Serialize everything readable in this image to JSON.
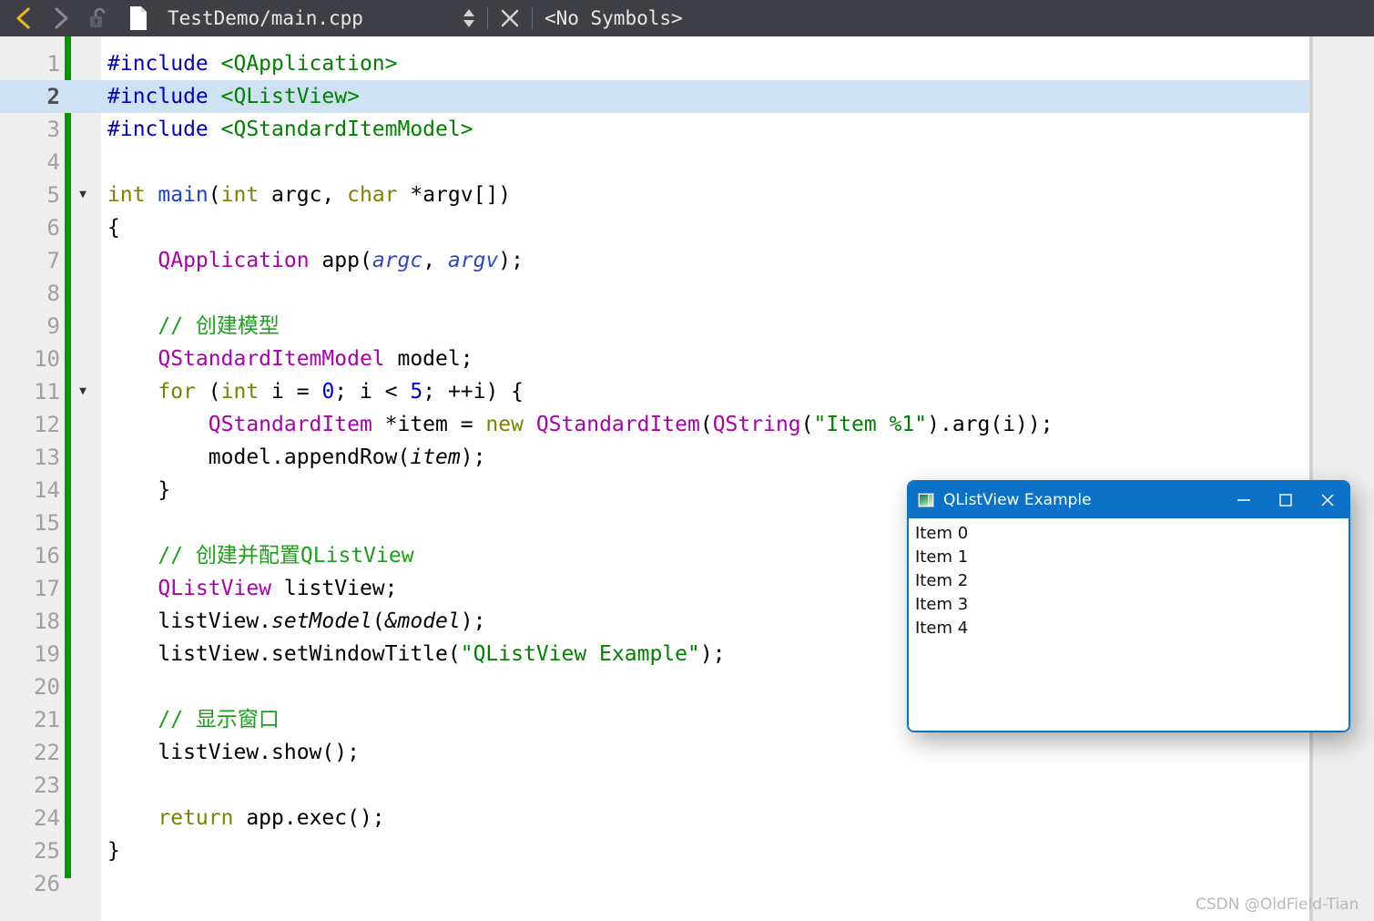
{
  "toolbar": {
    "back_icon": "chevron-left-icon",
    "forward_icon": "chevron-right-icon",
    "lock_icon": "unlocked-padlock-icon",
    "file_icon": "document-icon",
    "file_path": "TestDemo/main.cpp",
    "updown_icon": "up-down-arrows-icon",
    "close_icon": "close-x-icon",
    "symbols_label": "<No Symbols>",
    "bg_color": "#3f3f46",
    "back_icon_color": "#e8b424",
    "forward_icon_color": "#8a8a90"
  },
  "editor": {
    "gutter_bg": "#eeeeee",
    "change_bar_color": "#009900",
    "highlight_color": "#cfe2f3",
    "highlighted_line": 2,
    "fold_lines": [
      5,
      11
    ],
    "total_lines": 26,
    "lines": [
      {
        "n": "1",
        "tokens": [
          {
            "t": "#include ",
            "c": "s-pre"
          },
          {
            "t": "<QApplication>",
            "c": "s-str"
          }
        ]
      },
      {
        "n": "2",
        "tokens": [
          {
            "t": "#include ",
            "c": "s-pre"
          },
          {
            "t": "<QListView>",
            "c": "s-str"
          }
        ]
      },
      {
        "n": "3",
        "tokens": [
          {
            "t": "#include ",
            "c": "s-pre"
          },
          {
            "t": "<QStandardItemModel>",
            "c": "s-str"
          }
        ]
      },
      {
        "n": "4",
        "tokens": []
      },
      {
        "n": "5",
        "tokens": [
          {
            "t": "int ",
            "c": "s-kw"
          },
          {
            "t": "main",
            "c": "s-fn"
          },
          {
            "t": "(",
            "c": "s-plain"
          },
          {
            "t": "int",
            "c": "s-kw"
          },
          {
            "t": " argc, ",
            "c": "s-plain"
          },
          {
            "t": "char",
            "c": "s-kw"
          },
          {
            "t": " *argv[])",
            "c": "s-plain"
          }
        ]
      },
      {
        "n": "6",
        "tokens": [
          {
            "t": "{",
            "c": "s-plain"
          }
        ]
      },
      {
        "n": "7",
        "tokens": [
          {
            "t": "    ",
            "c": "s-plain"
          },
          {
            "t": "QApplication",
            "c": "s-type"
          },
          {
            "t": " app(",
            "c": "s-plain"
          },
          {
            "t": "argc",
            "c": "s-param"
          },
          {
            "t": ", ",
            "c": "s-plain"
          },
          {
            "t": "argv",
            "c": "s-param"
          },
          {
            "t": ");",
            "c": "s-plain"
          }
        ]
      },
      {
        "n": "8",
        "tokens": []
      },
      {
        "n": "9",
        "tokens": [
          {
            "t": "    // 创建模型",
            "c": "s-cmt"
          }
        ]
      },
      {
        "n": "10",
        "tokens": [
          {
            "t": "    ",
            "c": "s-plain"
          },
          {
            "t": "QStandardItemModel",
            "c": "s-type"
          },
          {
            "t": " model;",
            "c": "s-plain"
          }
        ]
      },
      {
        "n": "11",
        "tokens": [
          {
            "t": "    ",
            "c": "s-plain"
          },
          {
            "t": "for",
            "c": "s-kw"
          },
          {
            "t": " (",
            "c": "s-plain"
          },
          {
            "t": "int",
            "c": "s-kw"
          },
          {
            "t": " i = ",
            "c": "s-plain"
          },
          {
            "t": "0",
            "c": "s-num"
          },
          {
            "t": "; i < ",
            "c": "s-plain"
          },
          {
            "t": "5",
            "c": "s-num"
          },
          {
            "t": "; ++i) {",
            "c": "s-plain"
          }
        ]
      },
      {
        "n": "12",
        "tokens": [
          {
            "t": "        ",
            "c": "s-plain"
          },
          {
            "t": "QStandardItem",
            "c": "s-type"
          },
          {
            "t": " *item = ",
            "c": "s-plain"
          },
          {
            "t": "new",
            "c": "s-kw"
          },
          {
            "t": " ",
            "c": "s-plain"
          },
          {
            "t": "QStandardItem",
            "c": "s-type"
          },
          {
            "t": "(",
            "c": "s-plain"
          },
          {
            "t": "QString",
            "c": "s-type"
          },
          {
            "t": "(",
            "c": "s-plain"
          },
          {
            "t": "\"Item %1\"",
            "c": "s-str"
          },
          {
            "t": ").arg(i));",
            "c": "s-plain"
          }
        ]
      },
      {
        "n": "13",
        "tokens": [
          {
            "t": "        model.appendRow(",
            "c": "s-plain"
          },
          {
            "t": "item",
            "c": "s-meth"
          },
          {
            "t": ");",
            "c": "s-plain"
          }
        ]
      },
      {
        "n": "14",
        "tokens": [
          {
            "t": "    }",
            "c": "s-plain"
          }
        ]
      },
      {
        "n": "15",
        "tokens": []
      },
      {
        "n": "16",
        "tokens": [
          {
            "t": "    // 创建并配置QListView",
            "c": "s-cmt"
          }
        ]
      },
      {
        "n": "17",
        "tokens": [
          {
            "t": "    ",
            "c": "s-plain"
          },
          {
            "t": "QListView",
            "c": "s-type"
          },
          {
            "t": " listView;",
            "c": "s-plain"
          }
        ]
      },
      {
        "n": "18",
        "tokens": [
          {
            "t": "    listView.",
            "c": "s-plain"
          },
          {
            "t": "setModel",
            "c": "s-meth"
          },
          {
            "t": "(",
            "c": "s-plain"
          },
          {
            "t": "&model",
            "c": "s-meth"
          },
          {
            "t": ");",
            "c": "s-plain"
          }
        ]
      },
      {
        "n": "19",
        "tokens": [
          {
            "t": "    listView.setWindowTitle(",
            "c": "s-plain"
          },
          {
            "t": "\"QListView Example\"",
            "c": "s-str"
          },
          {
            "t": ");",
            "c": "s-plain"
          }
        ]
      },
      {
        "n": "20",
        "tokens": []
      },
      {
        "n": "21",
        "tokens": [
          {
            "t": "    // 显示窗口",
            "c": "s-cmt"
          }
        ]
      },
      {
        "n": "22",
        "tokens": [
          {
            "t": "    listView.show();",
            "c": "s-plain"
          }
        ]
      },
      {
        "n": "23",
        "tokens": []
      },
      {
        "n": "24",
        "tokens": [
          {
            "t": "    ",
            "c": "s-plain"
          },
          {
            "t": "return",
            "c": "s-kw"
          },
          {
            "t": " app.exec();",
            "c": "s-plain"
          }
        ]
      },
      {
        "n": "25",
        "tokens": [
          {
            "t": "}",
            "c": "s-plain"
          }
        ]
      },
      {
        "n": "26",
        "tokens": []
      }
    ]
  },
  "qt_window": {
    "title": "QListView Example",
    "app_icon": "qt-app-window-icon",
    "minimize_label": "—",
    "maximize_label": "☐",
    "close_label": "✕",
    "titlebar_color": "#0c72c8",
    "border_color": "#0c72c8",
    "items": [
      "Item 0",
      "Item 1",
      "Item 2",
      "Item 3",
      "Item 4"
    ]
  },
  "watermark": {
    "text": "CSDN @OldField-Tian"
  }
}
